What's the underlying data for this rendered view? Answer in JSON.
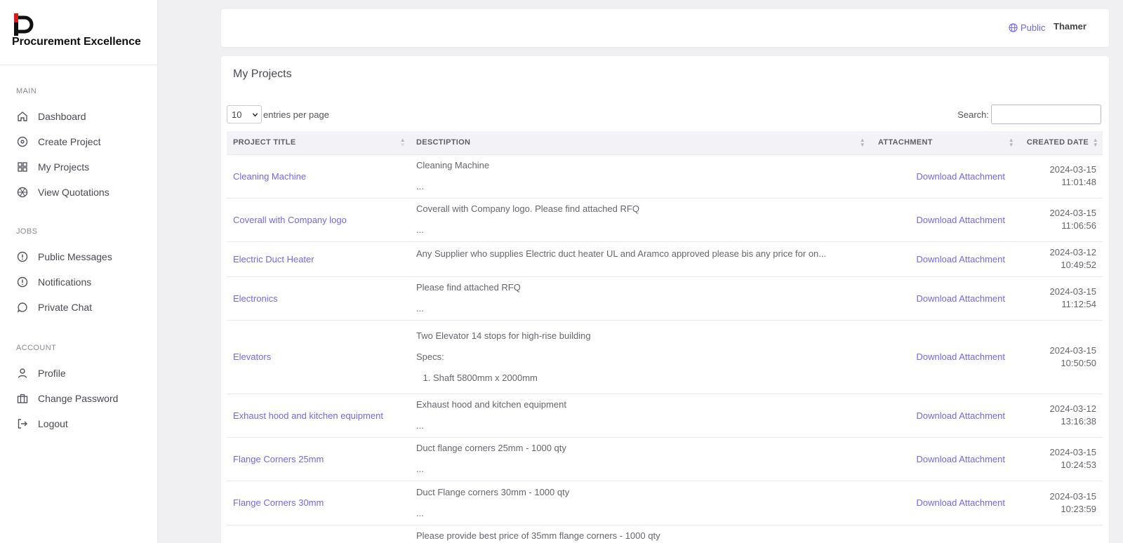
{
  "brand": {
    "name": "Procurement Excellence"
  },
  "sidebar": {
    "sections": [
      {
        "heading": "MAIN",
        "items": [
          {
            "label": "Dashboard",
            "icon": "home-icon"
          },
          {
            "label": "Create Project",
            "icon": "target-icon"
          },
          {
            "label": "My Projects",
            "icon": "grid-icon"
          },
          {
            "label": "View Quotations",
            "icon": "aperture-icon"
          }
        ]
      },
      {
        "heading": "JOBS",
        "items": [
          {
            "label": "Public Messages",
            "icon": "alert-circle-icon"
          },
          {
            "label": "Notifications",
            "icon": "alert-circle-icon"
          },
          {
            "label": "Private Chat",
            "icon": "chat-bubble-icon"
          }
        ]
      },
      {
        "heading": "ACCOUNT",
        "items": [
          {
            "label": "Profile",
            "icon": "user-icon"
          },
          {
            "label": "Change Password",
            "icon": "briefcase-icon"
          },
          {
            "label": "Logout",
            "icon": "logout-icon"
          }
        ]
      }
    ]
  },
  "topbar": {
    "public_label": "Public",
    "user_name": "Thamer"
  },
  "page": {
    "title": "My Projects",
    "length_value": "10",
    "length_label": "entries per page",
    "search_label": "Search:",
    "search_value": ""
  },
  "table": {
    "columns": [
      "PROJECT TITLE",
      "DESCTIPTION",
      "ATTACHMENT",
      "CREATED DATE"
    ],
    "rows": [
      {
        "title": "Cleaning Machine",
        "desc": [
          "Cleaning Machine",
          "..."
        ],
        "attachment": "Download Attachment",
        "date": [
          "2024-03-15 11:01:48"
        ]
      },
      {
        "title": "Coverall with Company logo",
        "desc": [
          "Coverall with Company logo. Please find attached RFQ",
          "..."
        ],
        "attachment": "Download Attachment",
        "date": [
          "2024-03-15",
          "11:06:56"
        ]
      },
      {
        "title": "Electric Duct Heater",
        "desc": [
          "Any Supplier who supplies Electric duct heater UL and Aramco approved please bis any price for on..."
        ],
        "attachment": "Download Attachment",
        "date": [
          "2024-03-12",
          "10:49:52"
        ]
      },
      {
        "title": "Electronics",
        "desc": [
          "Please find attached RFQ",
          "..."
        ],
        "attachment": "Download Attachment",
        "date": [
          "2024-03-15 11:12:54"
        ]
      },
      {
        "title": "Elevators",
        "desc": [
          "Two Elevator 14 stops for high-rise building",
          "Specs:"
        ],
        "desc_list": [
          "Shaft 5800mm x 2000mm"
        ],
        "attachment": "Download Attachment",
        "date": [
          "2024-03-15",
          "10:50:50"
        ]
      },
      {
        "title": "Exhaust hood and kitchen equipment",
        "desc": [
          "Exhaust hood and kitchen equipment",
          "..."
        ],
        "attachment": "Download Attachment",
        "date": [
          "2024-03-12 13:16:38"
        ]
      },
      {
        "title": "Flange Corners 25mm",
        "desc": [
          "Duct flange corners 25mm - 1000 qty",
          "..."
        ],
        "attachment": "Download Attachment",
        "date": [
          "2024-03-15",
          "10:24:53"
        ]
      },
      {
        "title": "Flange Corners 30mm",
        "desc": [
          "Duct Flange corners 30mm - 1000 qty",
          "..."
        ],
        "attachment": "Download Attachment",
        "date": [
          "2024-03-15",
          "10:23:59"
        ]
      },
      {
        "title": "",
        "desc": [
          "Please provide best price of 35mm flange corners - 1000 qty"
        ],
        "attachment": "",
        "date": []
      }
    ]
  },
  "colors": {
    "accent": "#7367f0",
    "brand_red": "#d71920"
  }
}
